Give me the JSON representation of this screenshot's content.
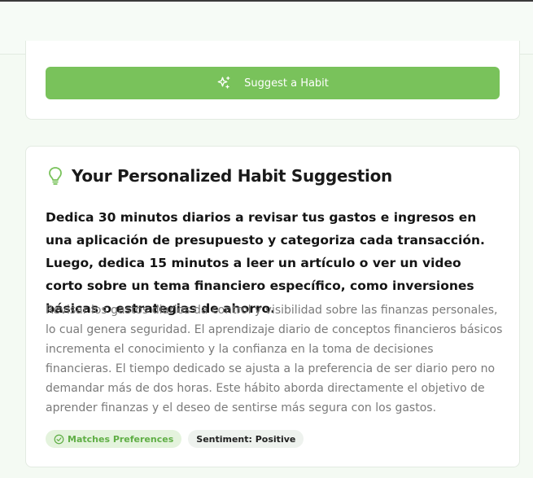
{
  "suggest": {
    "button_label": "Suggest a Habit",
    "icon": "sparkles-icon"
  },
  "result": {
    "icon": "lightbulb-icon",
    "title": "Your Personalized Habit Suggestion",
    "suggestion": "Dedica 30 minutos diarios a revisar tus gastos e ingresos en una aplicación de presupuesto y categoriza cada transacción. Luego, dedica 15 minutos a leer un artículo o ver un video corto sobre un tema financiero específico, como inversiones básicas o estrategias de ahorro.",
    "explanation": "Revisar los gastos diarios da control y visibilidad sobre las finanzas personales, lo cual genera seguridad. El aprendizaje diario de conceptos financieros básicos incrementa el conocimiento y la confianza en la toma de decisiones financieras. El tiempo dedicado se ajusta a la preferencia de ser diario pero no demandar más de dos horas. Este hábito aborda directamente el objetivo de aprender finanzas y el deseo de sentirse más segura con los gastos.",
    "badges": {
      "match_label": "Matches Preferences",
      "match_icon": "check-circle-icon",
      "sentiment_label": "Sentiment: Positive"
    }
  },
  "colors": {
    "accent": "#79c25b",
    "badge_match_bg": "#e4f3dd",
    "badge_match_text": "#5fae45",
    "page_bg": "#f4faf3"
  }
}
